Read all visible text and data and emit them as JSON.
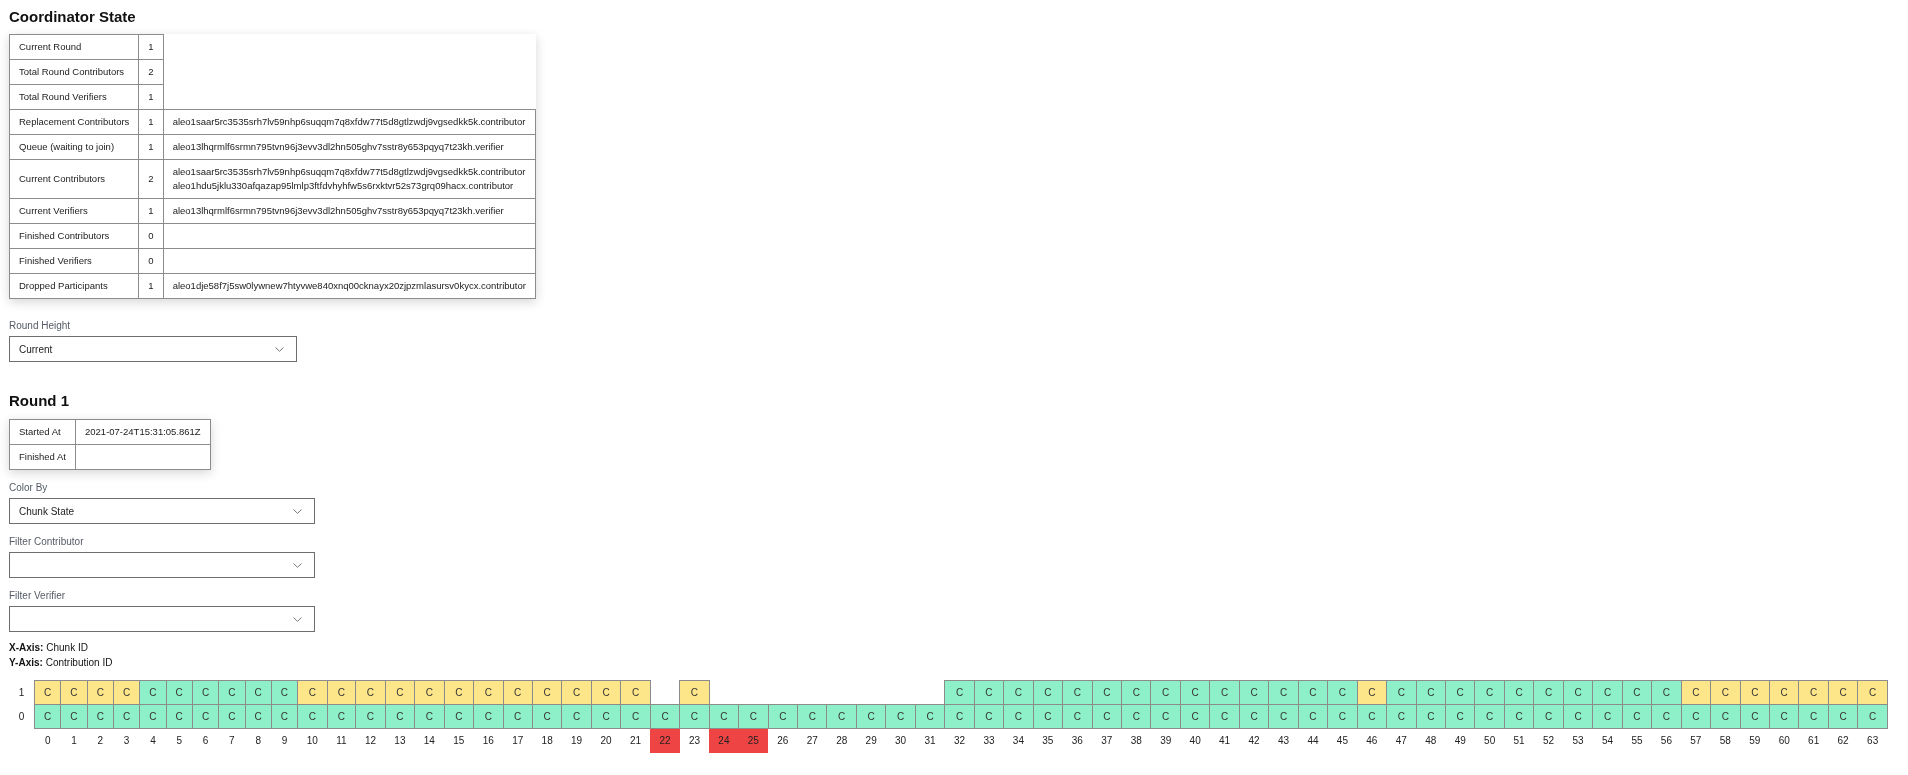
{
  "coordinator_state": {
    "title": "Coordinator State",
    "rows": [
      {
        "kind": "count",
        "label": "Current Round",
        "count": "1"
      },
      {
        "kind": "count",
        "label": "Total Round Contributors",
        "count": "2"
      },
      {
        "kind": "count",
        "label": "Total Round Verifiers",
        "count": "1"
      },
      {
        "kind": "participants",
        "label": "Replacement Contributors",
        "count": "1",
        "participants": [
          "aleo1saar5rc3535srh7lv59nhp6suqqm7q8xfdw77t5d8gtlzwdj9vgsedkk5k.contributor"
        ]
      },
      {
        "kind": "participants",
        "label": "Queue (waiting to join)",
        "count": "1",
        "participants": [
          "aleo13lhqrmlf6srmn795tvn96j3evv3dl2hn505ghv7sstr8y653pqyq7t23kh.verifier"
        ]
      },
      {
        "kind": "participants",
        "label": "Current Contributors",
        "count": "2",
        "participants": [
          "aleo1saar5rc3535srh7lv59nhp6suqqm7q8xfdw77t5d8gtlzwdj9vgsedkk5k.contributor",
          "aleo1hdu5jklu330afqazap95lmlp3ftfdvhyhfw5s6rxktvr52s73grq09hacx.contributor"
        ]
      },
      {
        "kind": "participants",
        "label": "Current Verifiers",
        "count": "1",
        "participants": [
          "aleo13lhqrmlf6srmn795tvn96j3evv3dl2hn505ghv7sstr8y653pqyq7t23kh.verifier"
        ]
      },
      {
        "kind": "participants",
        "label": "Finished Contributors",
        "count": "0"
      },
      {
        "kind": "participants",
        "label": "Finished Verifiers",
        "count": "0"
      },
      {
        "kind": "participants",
        "label": "Dropped Participants",
        "count": "1",
        "participants": [
          "aleo1dje58f7j5sw0lywnew7htyvwe840xnq00cknayx20zjpzmlasursv0kycx.contributor"
        ]
      }
    ]
  },
  "round_height": {
    "label": "Round Height",
    "value": "Current"
  },
  "round": {
    "title": "Round 1",
    "rows": [
      {
        "label": "Started At",
        "value": "2021-07-24T15:31:05.861Z"
      },
      {
        "label": "Finished At"
      }
    ]
  },
  "filters": [
    {
      "label": "Color By",
      "value": "Chunk State"
    },
    {
      "label": "Filter Contributor"
    },
    {
      "label": "Filter Verifier"
    }
  ],
  "axis_legend": [
    "**X-Axis:** Chunk ID",
    "**Y-Axis:** Contribution ID"
  ],
  "grid": {
    "rows": [
      {
        "label": "1",
        "cells": [
          {
            "label": "C",
            "color": "#fde68a"
          },
          {
            "label": "C",
            "color": "#fde68a"
          },
          {
            "label": "C",
            "color": "#fde68a"
          },
          {
            "label": "C",
            "color": "#fde68a"
          },
          {
            "label": "C",
            "color": "#8ef0c8"
          },
          {
            "label": "C",
            "color": "#8ef0c8"
          },
          {
            "label": "C",
            "color": "#8ef0c8"
          },
          {
            "label": "C",
            "color": "#8ef0c8"
          },
          {
            "label": "C",
            "color": "#8ef0c8"
          },
          {
            "label": "C",
            "color": "#8ef0c8"
          },
          {
            "label": "C",
            "color": "#fde68a"
          },
          {
            "label": "C",
            "color": "#fde68a"
          },
          {
            "label": "C",
            "color": "#fde68a"
          },
          {
            "label": "C",
            "color": "#fde68a"
          },
          {
            "label": "C",
            "color": "#fde68a"
          },
          {
            "label": "C",
            "color": "#fde68a"
          },
          {
            "label": "C",
            "color": "#fde68a"
          },
          {
            "label": "C",
            "color": "#fde68a"
          },
          {
            "label": "C",
            "color": "#fde68a"
          },
          {
            "label": "C",
            "color": "#fde68a"
          },
          {
            "label": "C",
            "color": "#fde68a"
          },
          {
            "label": "C",
            "color": "#fde68a"
          },
          null,
          {
            "label": "C",
            "color": "#fde68a"
          },
          null,
          null,
          null,
          null,
          null,
          null,
          null,
          null,
          {
            "label": "C",
            "color": "#8ef0c8"
          },
          {
            "label": "C",
            "color": "#8ef0c8"
          },
          {
            "label": "C",
            "color": "#8ef0c8"
          },
          {
            "label": "C",
            "color": "#8ef0c8"
          },
          {
            "label": "C",
            "color": "#8ef0c8"
          },
          {
            "label": "C",
            "color": "#8ef0c8"
          },
          {
            "label": "C",
            "color": "#8ef0c8"
          },
          {
            "label": "C",
            "color": "#8ef0c8"
          },
          {
            "label": "C",
            "color": "#8ef0c8"
          },
          {
            "label": "C",
            "color": "#8ef0c8"
          },
          {
            "label": "C",
            "color": "#8ef0c8"
          },
          {
            "label": "C",
            "color": "#8ef0c8"
          },
          {
            "label": "C",
            "color": "#8ef0c8"
          },
          {
            "label": "C",
            "color": "#8ef0c8"
          },
          {
            "label": "C",
            "color": "#fde68a"
          },
          {
            "label": "C",
            "color": "#8ef0c8"
          },
          {
            "label": "C",
            "color": "#8ef0c8"
          },
          {
            "label": "C",
            "color": "#8ef0c8"
          },
          {
            "label": "C",
            "color": "#8ef0c8"
          },
          {
            "label": "C",
            "color": "#8ef0c8"
          },
          {
            "label": "C",
            "color": "#8ef0c8"
          },
          {
            "label": "C",
            "color": "#8ef0c8"
          },
          {
            "label": "C",
            "color": "#8ef0c8"
          },
          {
            "label": "C",
            "color": "#8ef0c8"
          },
          {
            "label": "C",
            "color": "#8ef0c8"
          },
          {
            "label": "C",
            "color": "#fde68a"
          },
          {
            "label": "C",
            "color": "#fde68a"
          },
          {
            "label": "C",
            "color": "#fde68a"
          },
          {
            "label": "C",
            "color": "#fde68a"
          },
          {
            "label": "C",
            "color": "#fde68a"
          },
          {
            "label": "C",
            "color": "#fde68a"
          },
          {
            "label": "C",
            "color": "#fde68a"
          }
        ]
      },
      {
        "label": "0",
        "cells": [
          {
            "label": "C",
            "color": "#8ef0c8"
          },
          {
            "label": "C",
            "color": "#8ef0c8"
          },
          {
            "label": "C",
            "color": "#8ef0c8"
          },
          {
            "label": "C",
            "color": "#8ef0c8"
          },
          {
            "label": "C",
            "color": "#8ef0c8"
          },
          {
            "label": "C",
            "color": "#8ef0c8"
          },
          {
            "label": "C",
            "color": "#8ef0c8"
          },
          {
            "label": "C",
            "color": "#8ef0c8"
          },
          {
            "label": "C",
            "color": "#8ef0c8"
          },
          {
            "label": "C",
            "color": "#8ef0c8"
          },
          {
            "label": "C",
            "color": "#8ef0c8"
          },
          {
            "label": "C",
            "color": "#8ef0c8"
          },
          {
            "label": "C",
            "color": "#8ef0c8"
          },
          {
            "label": "C",
            "color": "#8ef0c8"
          },
          {
            "label": "C",
            "color": "#8ef0c8"
          },
          {
            "label": "C",
            "color": "#8ef0c8"
          },
          {
            "label": "C",
            "color": "#8ef0c8"
          },
          {
            "label": "C",
            "color": "#8ef0c8"
          },
          {
            "label": "C",
            "color": "#8ef0c8"
          },
          {
            "label": "C",
            "color": "#8ef0c8"
          },
          {
            "label": "C",
            "color": "#8ef0c8"
          },
          {
            "label": "C",
            "color": "#8ef0c8"
          },
          {
            "label": "C",
            "color": "#8ef0c8"
          },
          {
            "label": "C",
            "color": "#8ef0c8"
          },
          {
            "label": "C",
            "color": "#8ef0c8"
          },
          {
            "label": "C",
            "color": "#8ef0c8"
          },
          {
            "label": "C",
            "color": "#8ef0c8"
          },
          {
            "label": "C",
            "color": "#8ef0c8"
          },
          {
            "label": "C",
            "color": "#8ef0c8"
          },
          {
            "label": "C",
            "color": "#8ef0c8"
          },
          {
            "label": "C",
            "color": "#8ef0c8"
          },
          {
            "label": "C",
            "color": "#8ef0c8"
          },
          {
            "label": "C",
            "color": "#8ef0c8"
          },
          {
            "label": "C",
            "color": "#8ef0c8"
          },
          {
            "label": "C",
            "color": "#8ef0c8"
          },
          {
            "label": "C",
            "color": "#8ef0c8"
          },
          {
            "label": "C",
            "color": "#8ef0c8"
          },
          {
            "label": "C",
            "color": "#8ef0c8"
          },
          {
            "label": "C",
            "color": "#8ef0c8"
          },
          {
            "label": "C",
            "color": "#8ef0c8"
          },
          {
            "label": "C",
            "color": "#8ef0c8"
          },
          {
            "label": "C",
            "color": "#8ef0c8"
          },
          {
            "label": "C",
            "color": "#8ef0c8"
          },
          {
            "label": "C",
            "color": "#8ef0c8"
          },
          {
            "label": "C",
            "color": "#8ef0c8"
          },
          {
            "label": "C",
            "color": "#8ef0c8"
          },
          {
            "label": "C",
            "color": "#8ef0c8"
          },
          {
            "label": "C",
            "color": "#8ef0c8"
          },
          {
            "label": "C",
            "color": "#8ef0c8"
          },
          {
            "label": "C",
            "color": "#8ef0c8"
          },
          {
            "label": "C",
            "color": "#8ef0c8"
          },
          {
            "label": "C",
            "color": "#8ef0c8"
          },
          {
            "label": "C",
            "color": "#8ef0c8"
          },
          {
            "label": "C",
            "color": "#8ef0c8"
          },
          {
            "label": "C",
            "color": "#8ef0c8"
          },
          {
            "label": "C",
            "color": "#8ef0c8"
          },
          {
            "label": "C",
            "color": "#8ef0c8"
          },
          {
            "label": "C",
            "color": "#8ef0c8"
          },
          {
            "label": "C",
            "color": "#8ef0c8"
          },
          {
            "label": "C",
            "color": "#8ef0c8"
          },
          {
            "label": "C",
            "color": "#8ef0c8"
          },
          {
            "label": "C",
            "color": "#8ef0c8"
          },
          {
            "label": "C",
            "color": "#8ef0c8"
          },
          {
            "label": "C",
            "color": "#8ef0c8"
          }
        ]
      }
    ],
    "chunk_ids": [
      {
        "label": "0",
        "highlighted": false
      },
      {
        "label": "1",
        "highlighted": false
      },
      {
        "label": "2",
        "highlighted": false
      },
      {
        "label": "3",
        "highlighted": false
      },
      {
        "label": "4",
        "highlighted": false
      },
      {
        "label": "5",
        "highlighted": false
      },
      {
        "label": "6",
        "highlighted": false
      },
      {
        "label": "7",
        "highlighted": false
      },
      {
        "label": "8",
        "highlighted": false
      },
      {
        "label": "9",
        "highlighted": false
      },
      {
        "label": "10",
        "highlighted": false
      },
      {
        "label": "11",
        "highlighted": false
      },
      {
        "label": "12",
        "highlighted": false
      },
      {
        "label": "13",
        "highlighted": false
      },
      {
        "label": "14",
        "highlighted": false
      },
      {
        "label": "15",
        "highlighted": false
      },
      {
        "label": "16",
        "highlighted": false
      },
      {
        "label": "17",
        "highlighted": false
      },
      {
        "label": "18",
        "highlighted": false
      },
      {
        "label": "19",
        "highlighted": false
      },
      {
        "label": "20",
        "highlighted": false
      },
      {
        "label": "21",
        "highlighted": false
      },
      {
        "label": "22",
        "highlighted": true
      },
      {
        "label": "23",
        "highlighted": false
      },
      {
        "label": "24",
        "highlighted": true
      },
      {
        "label": "25",
        "highlighted": true
      },
      {
        "label": "26",
        "highlighted": false
      },
      {
        "label": "27",
        "highlighted": false
      },
      {
        "label": "28",
        "highlighted": false
      },
      {
        "label": "29",
        "highlighted": false
      },
      {
        "label": "30",
        "highlighted": false
      },
      {
        "label": "31",
        "highlighted": false
      },
      {
        "label": "32",
        "highlighted": false
      },
      {
        "label": "33",
        "highlighted": false
      },
      {
        "label": "34",
        "highlighted": false
      },
      {
        "label": "35",
        "highlighted": false
      },
      {
        "label": "36",
        "highlighted": false
      },
      {
        "label": "37",
        "highlighted": false
      },
      {
        "label": "38",
        "highlighted": false
      },
      {
        "label": "39",
        "highlighted": false
      },
      {
        "label": "40",
        "highlighted": false
      },
      {
        "label": "41",
        "highlighted": false
      },
      {
        "label": "42",
        "highlighted": false
      },
      {
        "label": "43",
        "highlighted": false
      },
      {
        "label": "44",
        "highlighted": false
      },
      {
        "label": "45",
        "highlighted": false
      },
      {
        "label": "46",
        "highlighted": false
      },
      {
        "label": "47",
        "highlighted": false
      },
      {
        "label": "48",
        "highlighted": false
      },
      {
        "label": "49",
        "highlighted": false
      },
      {
        "label": "50",
        "highlighted": false
      },
      {
        "label": "51",
        "highlighted": false
      },
      {
        "label": "52",
        "highlighted": false
      },
      {
        "label": "53",
        "highlighted": false
      },
      {
        "label": "54",
        "highlighted": false
      },
      {
        "label": "55",
        "highlighted": false
      },
      {
        "label": "56",
        "highlighted": false
      },
      {
        "label": "57",
        "highlighted": false
      },
      {
        "label": "58",
        "highlighted": false
      },
      {
        "label": "59",
        "highlighted": false
      },
      {
        "label": "60",
        "highlighted": false
      },
      {
        "label": "61",
        "highlighted": false
      },
      {
        "label": "62",
        "highlighted": false
      },
      {
        "label": "63",
        "highlighted": false
      }
    ]
  }
}
